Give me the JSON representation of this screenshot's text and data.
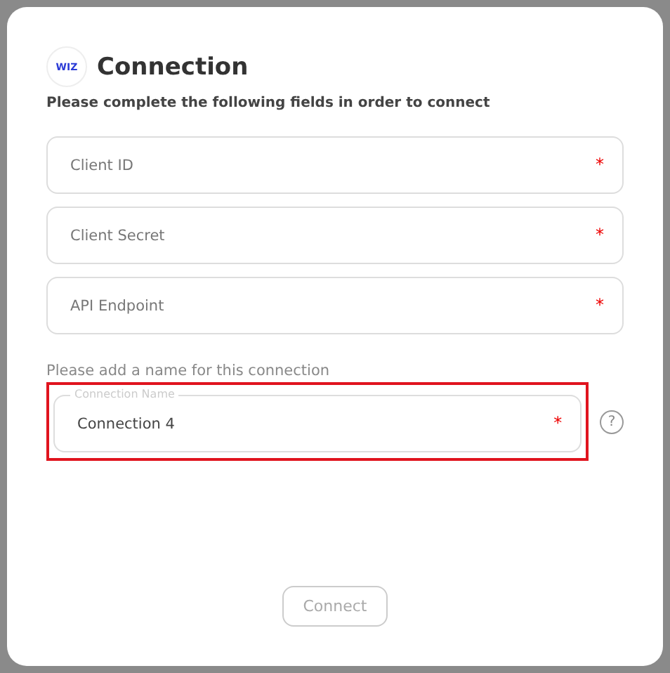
{
  "dialog": {
    "logo": "WIZ",
    "title": "Connection",
    "subtitle": "Please complete the following fields in order to connect"
  },
  "fields": [
    {
      "placeholder": "Client ID",
      "required_mark": "*"
    },
    {
      "placeholder": "Client Secret",
      "required_mark": "*"
    },
    {
      "placeholder": "API Endpoint",
      "required_mark": "*"
    }
  ],
  "name_section": {
    "prompt": "Please add a name for this connection",
    "field": {
      "label": "Connection Name",
      "value": "Connection 4",
      "required_mark": "*",
      "highlighted": true
    },
    "help": "?"
  },
  "connect_button": {
    "label": "Connect",
    "disabled": true
  }
}
